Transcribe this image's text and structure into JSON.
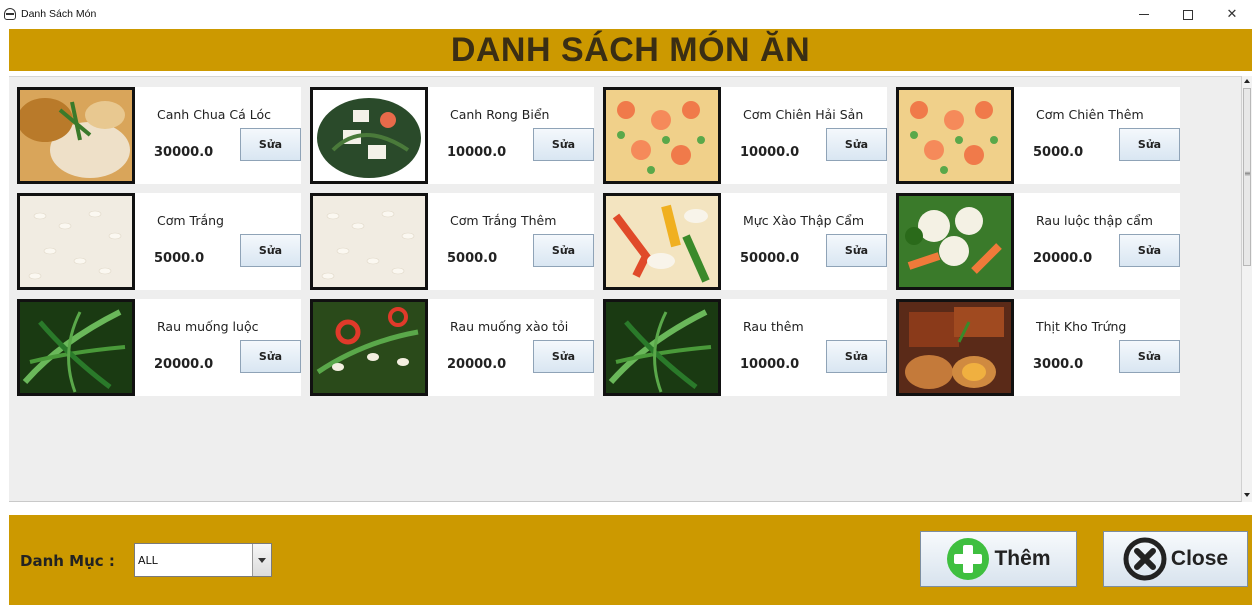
{
  "window": {
    "title": "Danh Sách Món",
    "minimize_label": "",
    "maximize_label": "",
    "close_label": "✕"
  },
  "header": {
    "title": "DANH SÁCH MÓN ĂN"
  },
  "items": [
    {
      "name": "Canh Chua Cá Lóc",
      "price": "30000.0",
      "edit_label": "Sửa",
      "image": "soup-fish-thumbnail"
    },
    {
      "name": "Canh Rong Biển",
      "price": "10000.0",
      "edit_label": "Sửa",
      "image": "seaweed-soup-thumbnail"
    },
    {
      "name": "Cơm Chiên Hải Sản",
      "price": "10000.0",
      "edit_label": "Sửa",
      "image": "fried-rice-thumbnail"
    },
    {
      "name": "Cơm Chiên Thêm",
      "price": "5000.0",
      "edit_label": "Sửa",
      "image": "fried-rice-thumbnail"
    },
    {
      "name": "Cơm Trắng",
      "price": "5000.0",
      "edit_label": "Sửa",
      "image": "white-rice-thumbnail"
    },
    {
      "name": "Cơm Trắng Thêm",
      "price": "5000.0",
      "edit_label": "Sửa",
      "image": "white-rice-thumbnail"
    },
    {
      "name": "Mực Xào Thập Cẩm",
      "price": "50000.0",
      "edit_label": "Sửa",
      "image": "squid-stirfry-thumbnail"
    },
    {
      "name": "Rau luộc thập cẩm",
      "price": "20000.0",
      "edit_label": "Sửa",
      "image": "boiled-vegetables-thumbnail"
    },
    {
      "name": "Rau muống luộc",
      "price": "20000.0",
      "edit_label": "Sửa",
      "image": "water-spinach-thumbnail"
    },
    {
      "name": "Rau muống xào tỏi",
      "price": "20000.0",
      "edit_label": "Sửa",
      "image": "spinach-garlic-thumbnail"
    },
    {
      "name": "Rau thêm",
      "price": "10000.0",
      "edit_label": "Sửa",
      "image": "water-spinach-thumbnail"
    },
    {
      "name": "Thịt Kho Trứng",
      "price": "3000.0",
      "edit_label": "Sửa",
      "image": "braised-pork-egg-thumbnail"
    }
  ],
  "footer": {
    "category_label": "Danh Mục :",
    "category_value": "ALL",
    "add_label": "Thêm",
    "close_label": "Close"
  },
  "colors": {
    "accent": "#cc9900",
    "title_text": "#3a2e14",
    "add_icon": "#3fbf3f",
    "close_icon": "#222222"
  }
}
